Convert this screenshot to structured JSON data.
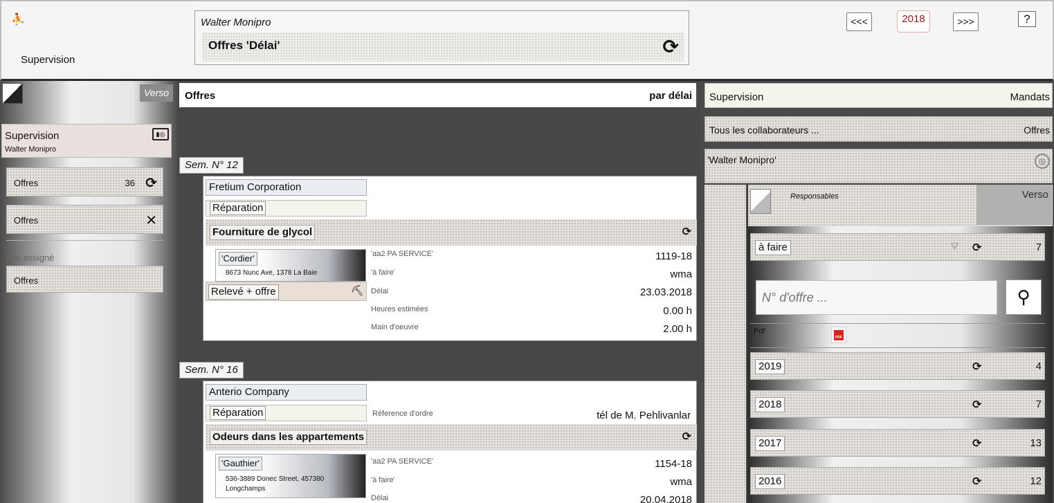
{
  "header": {
    "supervision_label": "Supervision",
    "user_name": "Walter Monipro",
    "title": "Offres 'Délai'",
    "prev_label": "<<<",
    "year": "2018",
    "next_label": ">>>",
    "help_label": "?"
  },
  "left": {
    "verso_label": "Verso",
    "user_card": {
      "title": "Supervision",
      "subtitle": "Walter Monipro"
    },
    "items": [
      {
        "label": "Offres",
        "count": "36"
      },
      {
        "label": "Offres"
      }
    ],
    "unassigned_label": "pas assigné",
    "unassigned_item": {
      "label": "Offres"
    }
  },
  "center": {
    "header_left": "Offres",
    "header_right": "par délai",
    "groups": [
      {
        "week": "Sem. N° 12",
        "company": "Fretium Corporation",
        "type": "Réparation",
        "subject": "Fourniture de glycol",
        "contact_name": "'Cordier'",
        "contact_address": "8673 Nunc Ave, 1378 La Baie",
        "task": "Relevé + offre",
        "fields": [
          {
            "label": "'aa2 PA SERVICE'",
            "value": "1119-18"
          },
          {
            "label": "'à faire'",
            "value": "wma"
          },
          {
            "label": "Délai",
            "value": "23.03.2018"
          },
          {
            "label": "Heures estimées",
            "value": "0.00 h"
          },
          {
            "label": "Main d'oeuvre",
            "value": "2.00 h"
          }
        ]
      },
      {
        "week": "Sem. N° 16",
        "company": "Anterio Company",
        "type": "Réparation",
        "order_ref_label": "Réference d'ordre",
        "order_ref_value": "tél de M. Pehlivanlar",
        "subject": "Odeurs dans les appartements",
        "contact_name": "'Gauthier'",
        "contact_address": "536-3889 Donec Street, 457380 Longchamps",
        "fields": [
          {
            "label": "'aa2 PA SERVICE'",
            "value": "1154-18"
          },
          {
            "label": "'à faire'",
            "value": "wma"
          },
          {
            "label": "Délai",
            "value": "20.04.2018"
          }
        ]
      }
    ]
  },
  "right": {
    "header_left": "Supervision",
    "header_right": "Mandats",
    "collab_left": "Tous les collaborateurs ...",
    "collab_right": "Offres",
    "user_filter": "'Walter Monipro'",
    "responsables_label": "Responsables",
    "verso_label": "Verso",
    "todo": {
      "label": "à faire",
      "count": "7"
    },
    "search_placeholder": "N° d'offre ...",
    "pdf_label": "Pdf",
    "pdf_icon_text": "PDF",
    "years": [
      {
        "label": "2019",
        "count": "4"
      },
      {
        "label": "2018",
        "count": "7"
      },
      {
        "label": "2017",
        "count": "13"
      },
      {
        "label": "2016",
        "count": "12"
      }
    ]
  }
}
